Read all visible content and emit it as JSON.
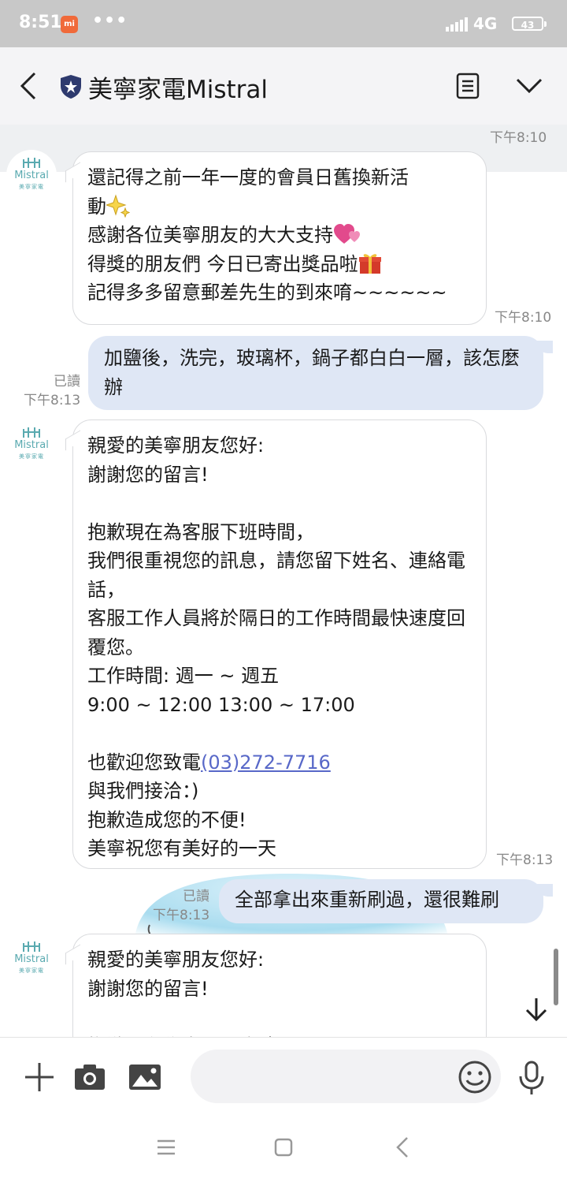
{
  "status_bar": {
    "time": "8:51",
    "mi_label": "mi",
    "dots": "•••",
    "network": "4G",
    "battery": "43"
  },
  "header": {
    "title": "美寧家電Mistral",
    "icons": [
      "back-chevron-icon",
      "shield-star-icon",
      "notes-icon",
      "chevron-down-icon"
    ]
  },
  "chat": {
    "top_timestamp": "下午8:10",
    "avatar_brand": "Mistral",
    "avatar_sub": "美寧家電",
    "messages": [
      {
        "sender": "incoming",
        "lines": [
          "還記得之前一年一度的會員日舊換新活",
          "動",
          "感謝各位美寧朋友的大大支持",
          "得獎的朋友們 今日已寄出獎品啦",
          "記得多多留意郵差先生的到來唷~~~~~~"
        ],
        "emojis": [
          "sparkles-emoji",
          "two-hearts-emoji",
          "gift-emoji"
        ],
        "time": "下午8:10"
      },
      {
        "sender": "outgoing",
        "text": "加鹽後，洗完，玻璃杯，鍋子都白白一層，該怎麼辦",
        "read": "已讀",
        "time": "下午8:13"
      },
      {
        "sender": "incoming",
        "text_before_phone": "親愛的美寧朋友您好:\n謝謝您的留言!\n\n抱歉現在為客服下班時間，\n我們很重視您的訊息，請您留下姓名、連絡電話，\n客服工作人員將於隔日的工作時間最快速度回覆您。\n工作時間: 週一 ~ 週五\n9:00 ~ 12:00 13:00 ~ 17:00\n\n也歡迎您致電",
        "phone": "(03)272-7716",
        "text_after_phone": "\n與我們接洽：)\n抱歉造成您的不便!\n美寧祝您有美好的一天",
        "time": "下午8:13"
      },
      {
        "sender": "outgoing",
        "text": "全部拿出來重新刷過，還很難刷",
        "read": "已讀",
        "time": "下午8:13"
      },
      {
        "sender": "incoming",
        "text": "親愛的美寧朋友您好:\n謝謝您的留言!\n\n抱歉現在為客服下班時間",
        "time": ""
      }
    ]
  },
  "input_bar": {
    "placeholder": "",
    "icons": [
      "plus-icon",
      "camera-icon",
      "image-icon",
      "emoji-icon",
      "microphone-icon"
    ]
  },
  "nav_bar": {
    "icons": [
      "menu-icon",
      "home-icon",
      "back-icon"
    ]
  },
  "colors": {
    "outgoing_bubble": "#dfe7f5",
    "incoming_bubble": "#ffffff",
    "link": "#5868c8",
    "header_bg": "#f4f4f6",
    "status_bg": "#c8c8c8"
  }
}
